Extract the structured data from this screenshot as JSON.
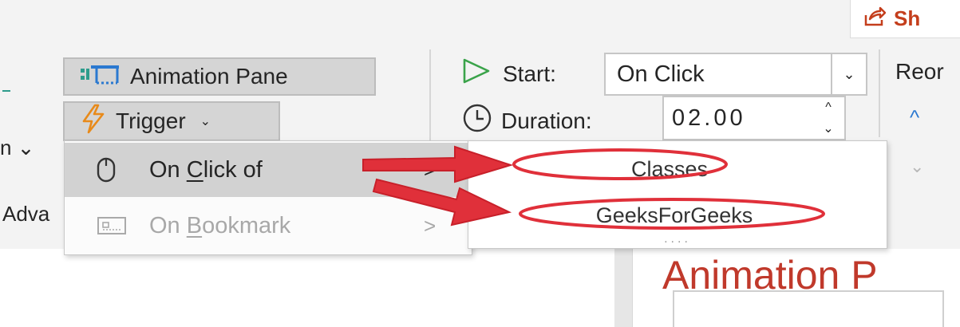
{
  "colors": {
    "ribbon_bg": "#f3f3f3",
    "accent_red": "#c43e1c",
    "annotation_red": "#e0303a",
    "pane_title_red": "#c0392b",
    "move_up_blue": "#2b79d0"
  },
  "header": {
    "share_label": "Sh",
    "share_icon": "share-icon"
  },
  "advanced_group": {
    "animation_pane_label": "Animation Pane",
    "trigger_label": "Trigger",
    "trigger_chevron": "⌄",
    "partial_left_label": "n ⌄",
    "advanced_label": "Adva"
  },
  "timing_group": {
    "start_label": "Start:",
    "start_value": "On Click",
    "duration_label": "Duration:",
    "duration_value": "02.00",
    "reorder_label": "Reor",
    "move_earlier": "^",
    "move_later": "⌄"
  },
  "trigger_menu": {
    "items": [
      {
        "pre": "On ",
        "underlined": "C",
        "post": "lick of",
        "icon": "mouse-icon",
        "enabled": true,
        "arrow": ">"
      },
      {
        "pre": "On ",
        "underlined": "B",
        "post": "ookmark",
        "icon": "bookmark-icon",
        "enabled": false,
        "arrow": ">"
      }
    ]
  },
  "submenu": {
    "items": [
      "Classes",
      "GeeksForGeeks"
    ],
    "more": "...."
  },
  "animation_pane": {
    "title": "Animation P"
  }
}
